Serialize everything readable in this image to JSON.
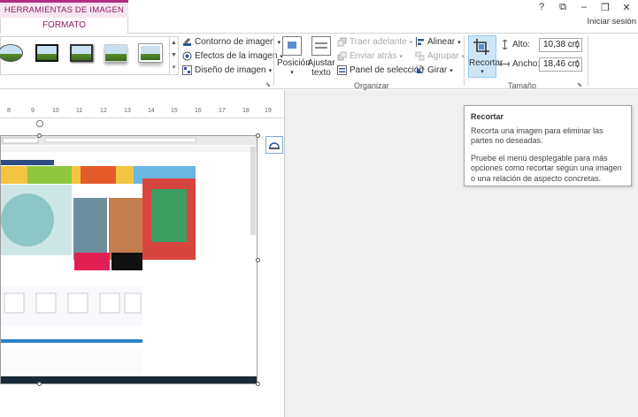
{
  "contextual_tab": {
    "group_title": "HERRAMIENTAS DE IMAGEN",
    "tab_label": "FORMATO"
  },
  "window": {
    "help": "?",
    "restore_ribbon": "⧉",
    "minimize": "–",
    "maximize": "❐",
    "close": "✕",
    "signin_label": "Iniciar sesión"
  },
  "ribbon": {
    "styles": {
      "gallery_items": [
        "style-1",
        "style-2",
        "style-3",
        "style-4",
        "style-5"
      ],
      "picture_border": "Contorno de imagen",
      "picture_effects": "Efectos de la imagen",
      "picture_layout": "Diseño de imagen"
    },
    "arrange": {
      "position": "Posición",
      "wrap_text": "Ajustar texto",
      "bring_forward": "Traer adelante",
      "send_backward": "Enviar atrás",
      "selection_pane": "Panel de selección",
      "align": "Alinear",
      "group": "Agrupar",
      "rotate": "Girar",
      "group_label": "Organizar"
    },
    "size": {
      "crop": "Recortar",
      "height_label": "Alto:",
      "height_value": "10,38 cm",
      "width_label": "Ancho:",
      "width_value": "18,46 cm",
      "group_label": "Tamaño"
    }
  },
  "ruler": {
    "ticks": [
      "8",
      "9",
      "10",
      "11",
      "12",
      "13",
      "14",
      "15",
      "16",
      "17",
      "18",
      "19"
    ]
  },
  "tooltip": {
    "title": "Recortar",
    "line1": "Recorta una imagen para eliminar las partes no deseadas.",
    "line2": "Pruebe el menú desplegable para más opciones como recortar según una imagen o una relación de aspecto concretas."
  },
  "colors": {
    "context_accent": "#b12d81",
    "context_text": "#8c1d63",
    "selected_button": "#cde6f7"
  }
}
